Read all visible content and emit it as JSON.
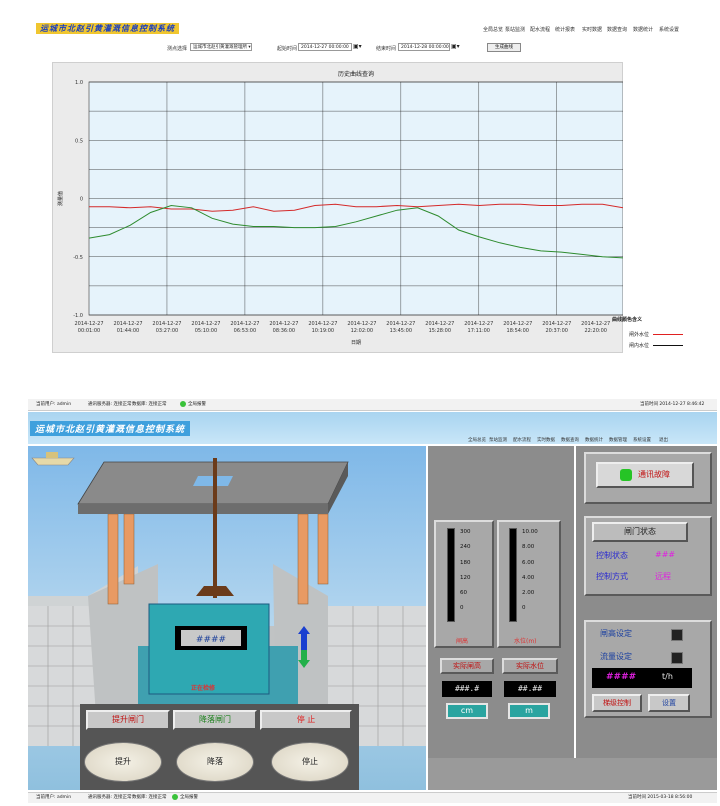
{
  "top": {
    "app_title": "运城市北赵引黄灌溉信息控制系统",
    "nav": [
      "全局总览",
      "泵站监测",
      "配水流程",
      "统计报表",
      "实时数据",
      "数据查询",
      "数据统计",
      "系统设置"
    ],
    "filters": {
      "station_label": "测点选择",
      "station_value": "运城市北赵引黄灌溉管理所",
      "start_label": "起始时间",
      "start_value": "2014-12-27 00:00:00",
      "end_label": "结束时间",
      "end_value": "2014-12-28 00:00:00",
      "query_button": "生成曲线"
    },
    "legend_title": "曲线颜色含义",
    "legend": [
      {
        "label": "闸外水位",
        "color": "#e02020"
      },
      {
        "label": "闸内水位",
        "color": "#111111"
      }
    ]
  },
  "chart_data": {
    "type": "line",
    "title": "历史曲线查询",
    "xlabel": "日期",
    "ylabel": "测量值",
    "ylim": [
      -1.0,
      1.0
    ],
    "y_ticks": [
      "1.0",
      "0.5",
      "0",
      "-0.5",
      "-1.0"
    ],
    "x_ticks": [
      [
        "2014-12-27",
        "00:01:00"
      ],
      [
        "2014-12-27",
        "01:44:00"
      ],
      [
        "2014-12-27",
        "03:27:00"
      ],
      [
        "2014-12-27",
        "05:10:00"
      ],
      [
        "2014-12-27",
        "06:53:00"
      ],
      [
        "2014-12-27",
        "08:36:00"
      ],
      [
        "2014-12-27",
        "10:19:00"
      ],
      [
        "2014-12-27",
        "12:02:00"
      ],
      [
        "2014-12-27",
        "13:45:00"
      ],
      [
        "2014-12-27",
        "15:28:00"
      ],
      [
        "2014-12-27",
        "17:11:00"
      ],
      [
        "2014-12-27",
        "18:54:00"
      ],
      [
        "2014-12-27",
        "20:37:00"
      ],
      [
        "2014-12-27",
        "22:20:00"
      ]
    ],
    "series": [
      {
        "color": "#d42a2a",
        "values": [
          -0.07,
          -0.07,
          -0.08,
          -0.07,
          -0.09,
          -0.09,
          -0.11,
          -0.1,
          -0.07,
          -0.11,
          -0.1,
          -0.06,
          -0.05,
          -0.07,
          -0.07,
          -0.06,
          -0.07,
          -0.06,
          -0.05,
          -0.06,
          -0.05,
          -0.05,
          -0.06,
          -0.06,
          -0.05,
          -0.05,
          -0.08
        ]
      },
      {
        "color": "#2e8b2e",
        "values": [
          -0.34,
          -0.31,
          -0.23,
          -0.12,
          -0.06,
          -0.08,
          -0.17,
          -0.22,
          -0.24,
          -0.24,
          -0.25,
          -0.25,
          -0.24,
          -0.2,
          -0.15,
          -0.1,
          -0.08,
          -0.15,
          -0.27,
          -0.33,
          -0.38,
          -0.42,
          -0.45,
          -0.46,
          -0.48,
          -0.5,
          -0.51
        ]
      }
    ]
  },
  "bottom": {
    "status": {
      "user": "当前用户: admin",
      "comm": "通讯服务器: 连接正常",
      "db": "数据库: 连接正常",
      "alarm": "全局报警",
      "time_top": "当前时间  2014-12-27 8:46:42",
      "time_bottom": "当前时间  2015-03-18 8:56:00"
    },
    "app_title": "运城市北赵引黄灌溉信息控制系统",
    "nav": [
      "全局总览",
      "泵站监测",
      "配水流程",
      "实时数据",
      "数据查询",
      "数据统计",
      "数据管理",
      "系统设置",
      "退出"
    ],
    "gate_display": "####",
    "maintenance_label": "正在检修",
    "control_buttons": [
      "提升闸门",
      "降落闸门",
      "停  止"
    ],
    "action_buttons": [
      "提升",
      "降落",
      "停止"
    ],
    "gauges": {
      "gate_scale": [
        "300",
        "240",
        "180",
        "120",
        "60",
        "0"
      ],
      "gate_caption": "闸高",
      "water_scale": [
        "10.00",
        "8.00",
        "6.00",
        "4.00",
        "2.00",
        "0"
      ],
      "water_caption": "水位(m)",
      "gate_label": "实际闸高",
      "gate_value": "###.#",
      "gate_unit": "cm",
      "water_label": "实际水位",
      "water_value": "##.##",
      "water_unit": "m"
    },
    "right": {
      "comm_fault": "通讯故障",
      "gate_status_title": "闸门状态",
      "control_status_label": "控制状态",
      "control_status_value": "###",
      "control_mode_label": "控制方式",
      "control_mode_value": "远程",
      "gate_height_set": "闸高设定",
      "flow_set": "流量设定",
      "flow_value": "####",
      "flow_unit": "t/h",
      "cascade_button": "梯级控制",
      "settings_button": "设置"
    }
  }
}
